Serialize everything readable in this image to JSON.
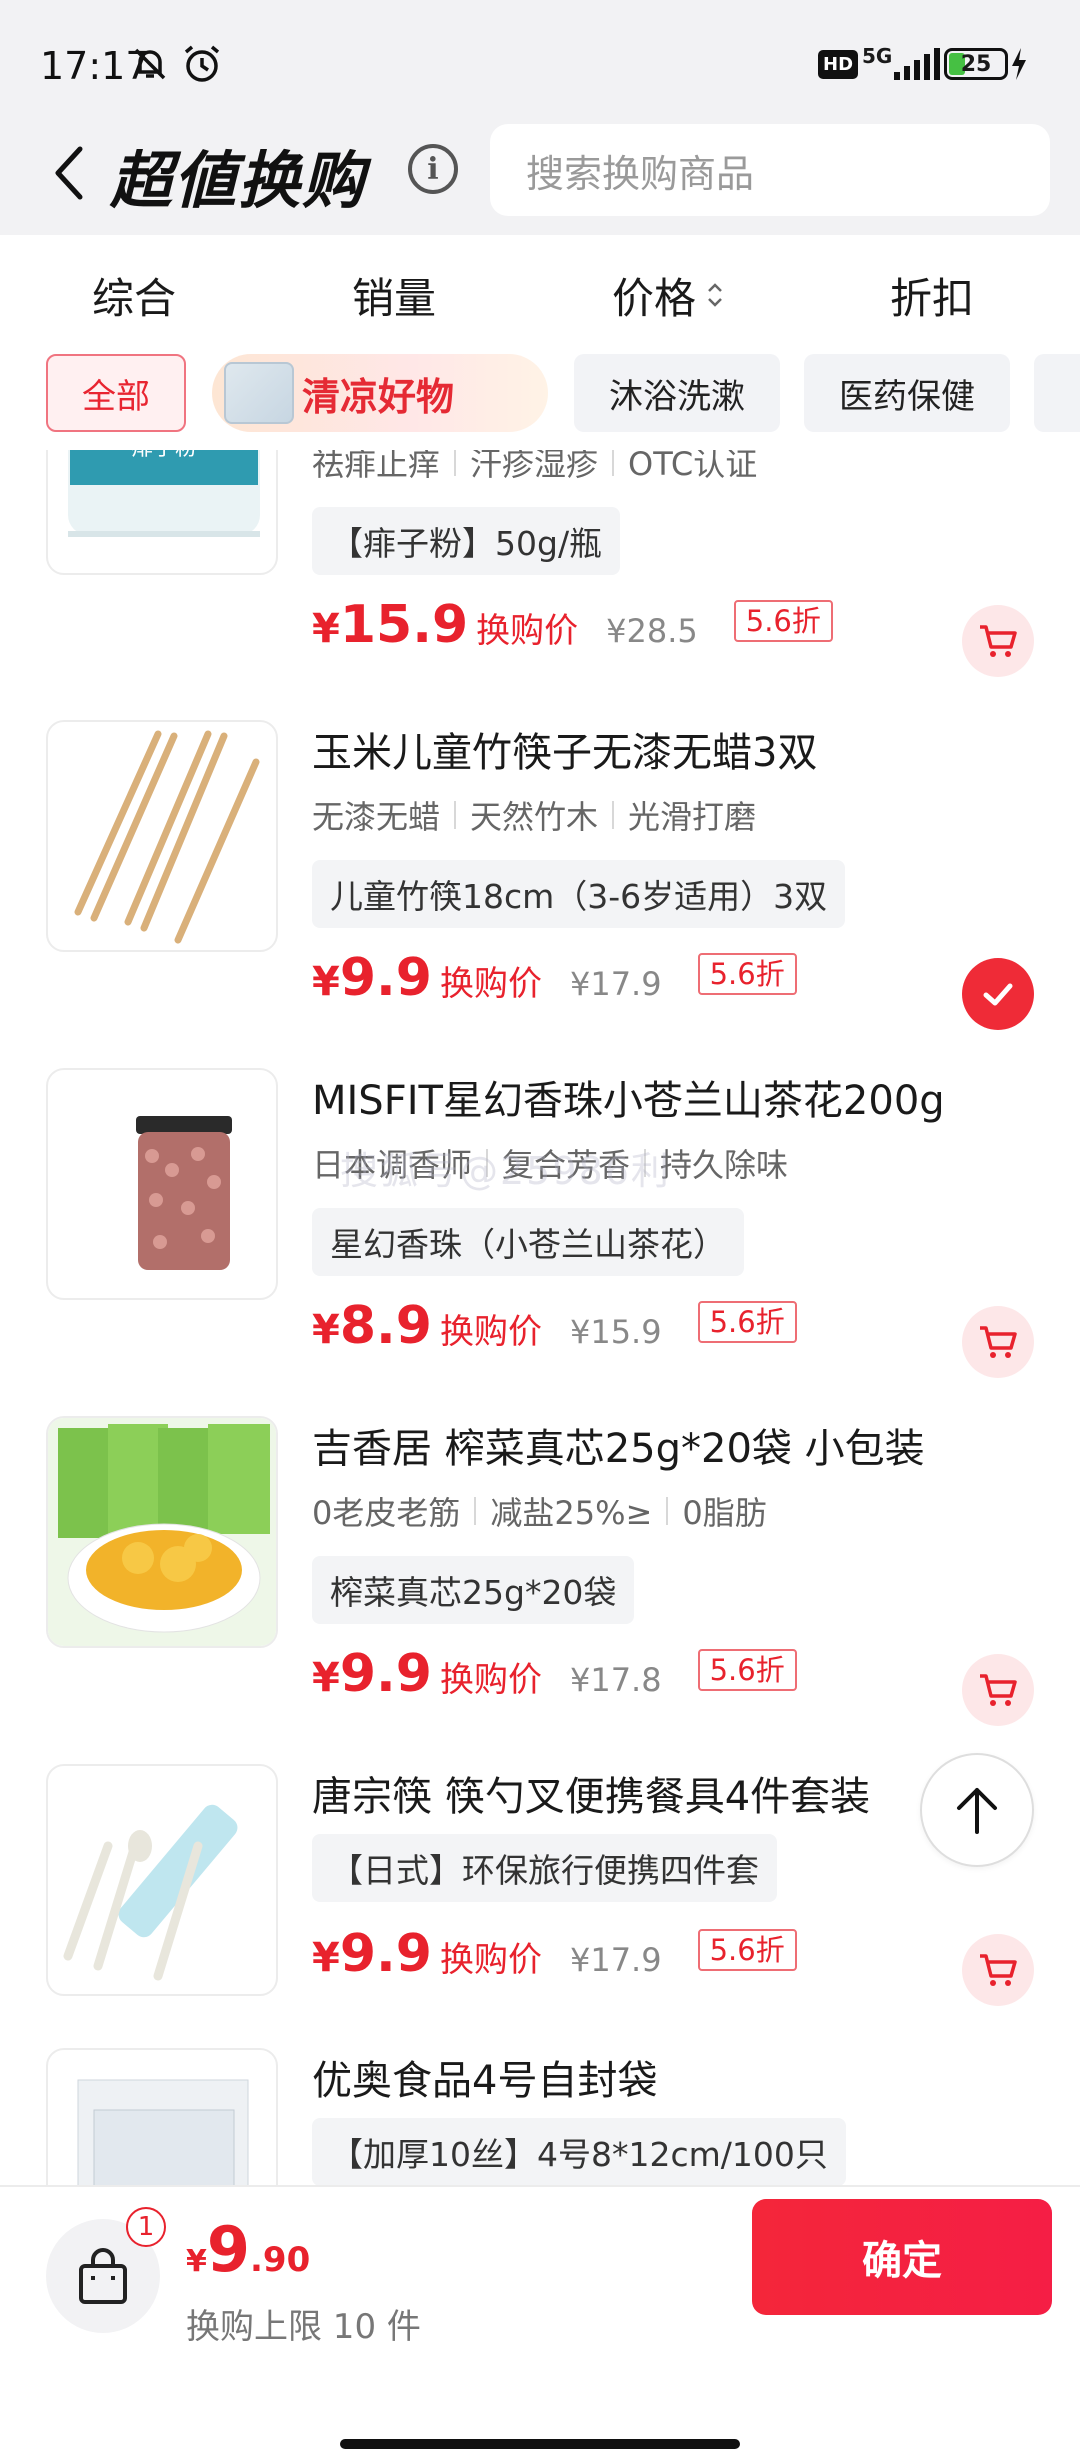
{
  "status_bar": {
    "time": "17:17",
    "network": "5G",
    "battery": "25",
    "hd_label": "HD"
  },
  "header": {
    "title": "超値换购",
    "search_placeholder": "搜索换购商品"
  },
  "sort_tabs": [
    "综合",
    "销量",
    "价格",
    "折扣"
  ],
  "categories": {
    "all": "全部",
    "featured": "清凉好物",
    "items": [
      "沐浴洗漱",
      "医药保健"
    ]
  },
  "products": [
    {
      "title": "",
      "tags": [
        "祛痱止痒",
        "汗疹湿疹",
        "OTC认证"
      ],
      "spec": "【痱子粉】50g/瓶",
      "price": "15.9",
      "price_label": "换购价",
      "original_price": "¥28.5",
      "discount": "5.6折",
      "selected": false
    },
    {
      "title": "玉米儿童竹筷子无漆无蜡3双",
      "tags": [
        "无漆无蜡",
        "天然竹木",
        "光滑打磨"
      ],
      "spec": "儿童竹筷18cm（3-6岁适用）3双",
      "price": "9.9",
      "price_label": "换购价",
      "original_price": "¥17.9",
      "discount": "5.6折",
      "selected": true
    },
    {
      "title": "MISFIT星幻香珠小苍兰山茶花200g",
      "tags": [
        "日本调香师",
        "复合芳香",
        "持久除味"
      ],
      "spec": "星幻香珠（小苍兰山茶花）",
      "price": "8.9",
      "price_label": "换购价",
      "original_price": "¥15.9",
      "discount": "5.6折",
      "selected": false
    },
    {
      "title": "吉香居 榨菜真芯25g*20袋 小包装",
      "tags": [
        "0老皮老筋",
        "减盐25%≥",
        "0脂肪"
      ],
      "spec": "榨菜真芯25g*20袋",
      "price": "9.9",
      "price_label": "换购价",
      "original_price": "¥17.8",
      "discount": "5.6折",
      "selected": false
    },
    {
      "title": "唐宗筷 筷勺叉便携餐具4件套装",
      "tags": [],
      "spec": "【日式】环保旅行便携四件套",
      "price": "9.9",
      "price_label": "换购价",
      "original_price": "¥17.9",
      "discount": "5.6折",
      "selected": false
    },
    {
      "title": "优奥食品4号自封袋",
      "tags": [],
      "spec": "【加厚10丝】4号8*12cm/100只",
      "price": "",
      "price_label": "",
      "original_price": "",
      "discount": "",
      "selected": false
    }
  ],
  "watermark": "搜狐号@25986利",
  "bottom_bar": {
    "badge_count": "1",
    "currency": "¥",
    "total_int": "9",
    "total_dec": ".90",
    "limit_text": "换购上限 10 件",
    "confirm_label": "确定"
  },
  "colors": {
    "accent": "#e8222d",
    "header_bg": "#f2f2f4"
  }
}
